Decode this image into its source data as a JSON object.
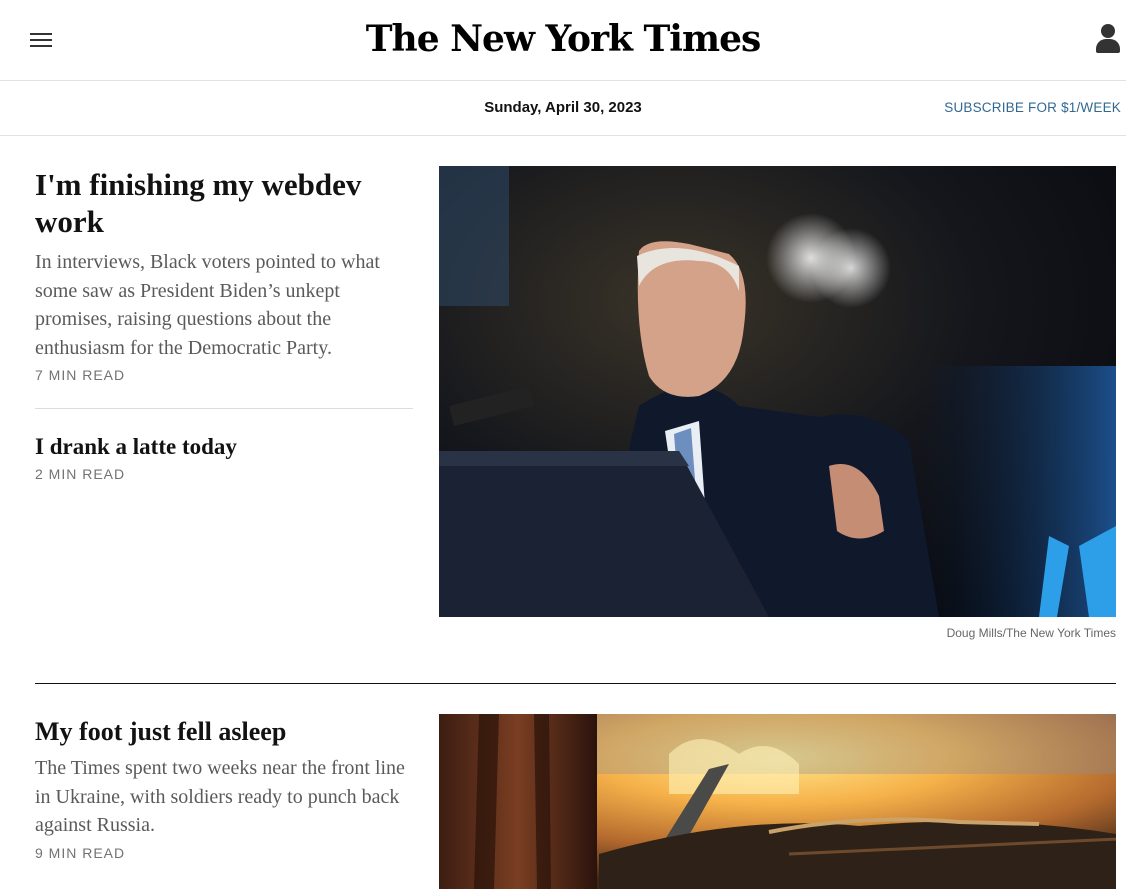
{
  "header": {
    "logo": "The New York Times",
    "menu_icon": "hamburger-menu-icon",
    "user_icon": "user-account-icon"
  },
  "datebar": {
    "date": "Sunday, April 30, 2023",
    "subscribe": "SUBSCRIBE FOR $1/WEEK"
  },
  "stories": [
    {
      "headline": "I'm finishing my webdev work",
      "summary": "In interviews, Black voters pointed to what some saw as President Biden’s unkept promises, raising questions about the enthusiasm for the Democratic Party.",
      "read_time": "7 MIN READ",
      "photo_credit": "Doug Mills/The New York Times"
    },
    {
      "headline": "I drank a latte today",
      "read_time": "2 MIN READ"
    },
    {
      "headline": "My foot just fell asleep",
      "summary": "The Times spent two weeks near the front line in Ukraine, with soldiers ready to punch back against Russia.",
      "read_time": "9 MIN READ"
    }
  ],
  "colors": {
    "link": "#326891",
    "text": "#121212",
    "summary": "#5a5a5a",
    "meta": "#727272"
  }
}
